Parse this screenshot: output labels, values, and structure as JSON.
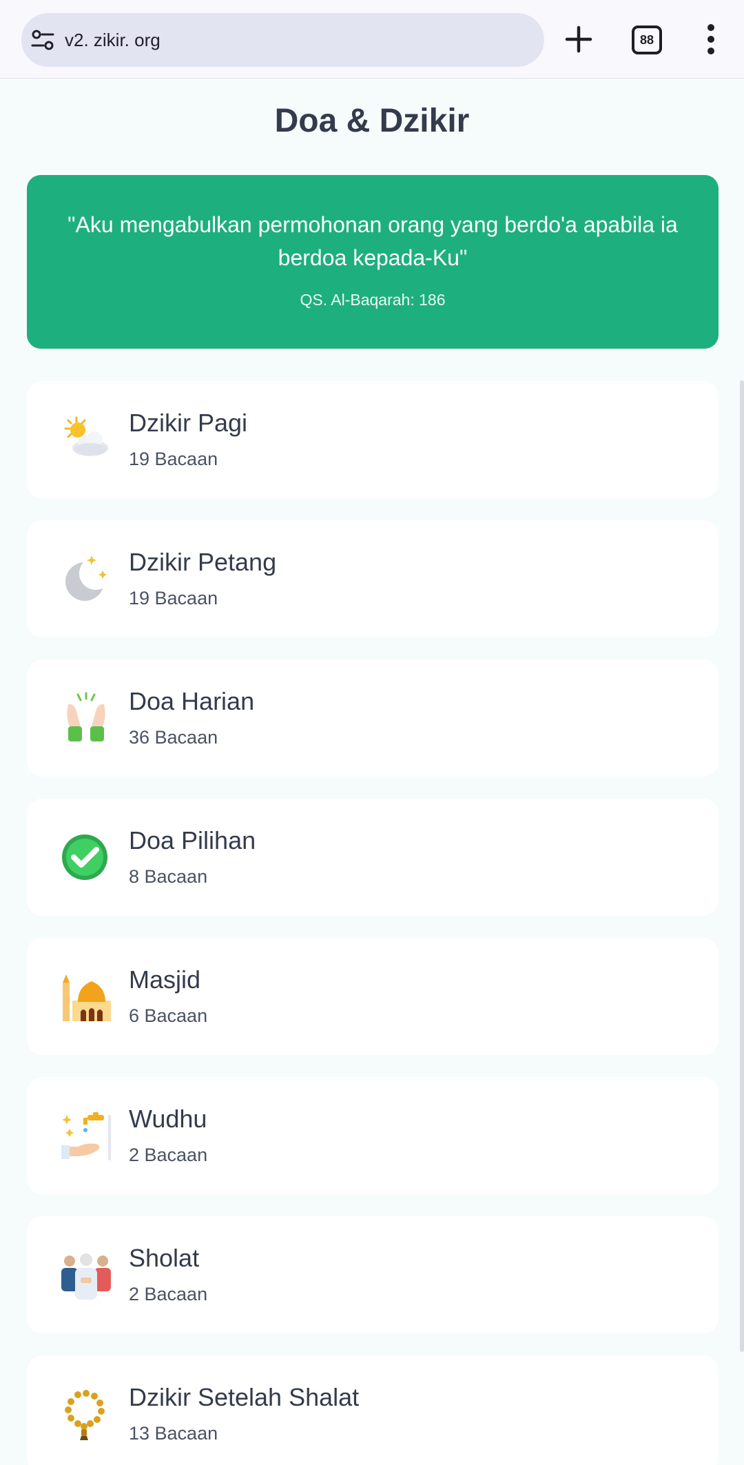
{
  "browser": {
    "url": "v2. zikir. org",
    "tab_count": "88"
  },
  "page": {
    "title": "Doa & Dzikir"
  },
  "quote": {
    "text": "\"Aku mengabulkan permohonan orang yang berdo'a apabila ia berdoa kepada-Ku\"",
    "reference": "QS. Al-Baqarah: 186"
  },
  "categories": [
    {
      "title": "Dzikir Pagi",
      "count": "19 Bacaan",
      "icon": "sun-behind-cloud-icon"
    },
    {
      "title": "Dzikir Petang",
      "count": "19 Bacaan",
      "icon": "crescent-moon-icon"
    },
    {
      "title": "Doa Harian",
      "count": "36 Bacaan",
      "icon": "praying-hands-icon"
    },
    {
      "title": "Doa Pilihan",
      "count": "8 Bacaan",
      "icon": "check-mark-icon"
    },
    {
      "title": "Masjid",
      "count": "6 Bacaan",
      "icon": "mosque-icon"
    },
    {
      "title": "Wudhu",
      "count": "2 Bacaan",
      "icon": "faucet-hand-icon"
    },
    {
      "title": "Sholat",
      "count": "2 Bacaan",
      "icon": "people-praying-icon"
    },
    {
      "title": "Dzikir Setelah Shalat",
      "count": "13 Bacaan",
      "icon": "prayer-beads-icon"
    }
  ],
  "colors": {
    "accent": "#1eaf7e",
    "title_text": "#333b4c",
    "background": "#f6fbfb"
  }
}
